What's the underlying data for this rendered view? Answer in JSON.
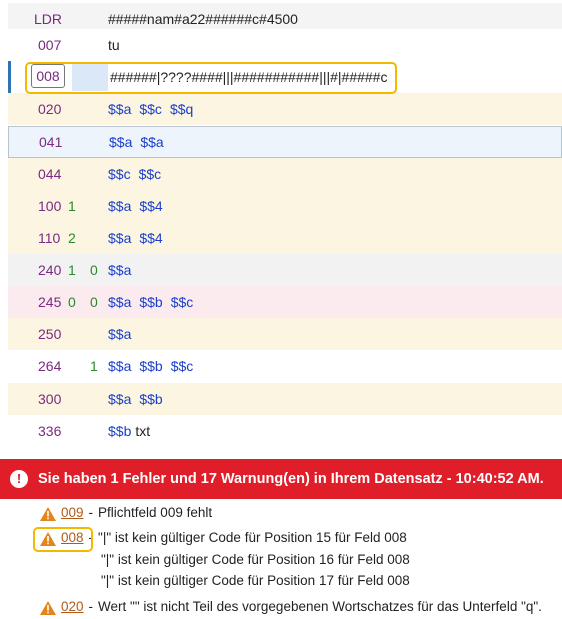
{
  "rows": [
    {
      "tag": "LDR",
      "ind1": "",
      "ind2": "",
      "content": "#####nam#a22######c#4500"
    },
    {
      "tag": "007",
      "ind1": "",
      "ind2": "",
      "content": "tu"
    },
    {
      "tag": "008",
      "ind1": "",
      "ind2": "",
      "content": "######|????####|||###########|||#|#####c"
    },
    {
      "tag": "020",
      "ind1": "",
      "ind2": "",
      "subfields": [
        "$$a",
        "$$c",
        "$$q"
      ]
    },
    {
      "tag": "041",
      "ind1": "",
      "ind2": "",
      "subfields": [
        "$$a",
        "$$a"
      ]
    },
    {
      "tag": "044",
      "ind1": "",
      "ind2": "",
      "subfields": [
        "$$c",
        "$$c"
      ]
    },
    {
      "tag": "100",
      "ind1": "1",
      "ind2": "",
      "subfields": [
        "$$a",
        "$$4"
      ]
    },
    {
      "tag": "110",
      "ind1": "2",
      "ind2": "",
      "subfields": [
        "$$a",
        "$$4"
      ]
    },
    {
      "tag": "240",
      "ind1": "1",
      "ind2": "0",
      "subfields": [
        "$$a"
      ]
    },
    {
      "tag": "245",
      "ind1": "0",
      "ind2": "0",
      "subfields": [
        "$$a",
        "$$b",
        "$$c"
      ]
    },
    {
      "tag": "250",
      "ind1": "",
      "ind2": "",
      "subfields": [
        "$$a"
      ]
    },
    {
      "tag": "264",
      "ind1": "",
      "ind2": "1",
      "subfields": [
        "$$a",
        "$$b",
        "$$c"
      ]
    },
    {
      "tag": "300",
      "ind1": "",
      "ind2": "",
      "subfields": [
        "$$a",
        "$$b"
      ]
    },
    {
      "tag": "336",
      "ind1": "",
      "ind2": "",
      "subfield": "$$b",
      "value": "txt"
    }
  ],
  "banner": {
    "icon": "exclamation-circle-icon",
    "text": "Sie haben 1 Fehler und 17 Warnung(en) in Ihrem Datensatz - 10:40:52 AM."
  },
  "messages": [
    {
      "field": "009",
      "sep": "-",
      "lines": [
        "Pflichtfeld 009 fehlt"
      ]
    },
    {
      "field": "008",
      "sep": "-",
      "lines": [
        "\"|\" ist kein gültiger Code für Position 15 für Feld 008",
        "\"|\" ist kein gültiger Code für Position 16 für Feld 008",
        "\"|\" ist kein gültiger Code für Position 17 für Feld 008"
      ]
    },
    {
      "field": "020",
      "sep": "-",
      "lines": [
        "Wert \"\" ist nicht Teil des vorgegebenen Wortschatzes für das Unterfeld \"q\"."
      ]
    }
  ],
  "colors": {
    "banner": "#e01e2a",
    "highlight": "#f5b800",
    "tag": "#7a2a80",
    "subfield": "#1a3fc9",
    "indicator": "#2a8a2a",
    "warning": "#e3861b"
  }
}
